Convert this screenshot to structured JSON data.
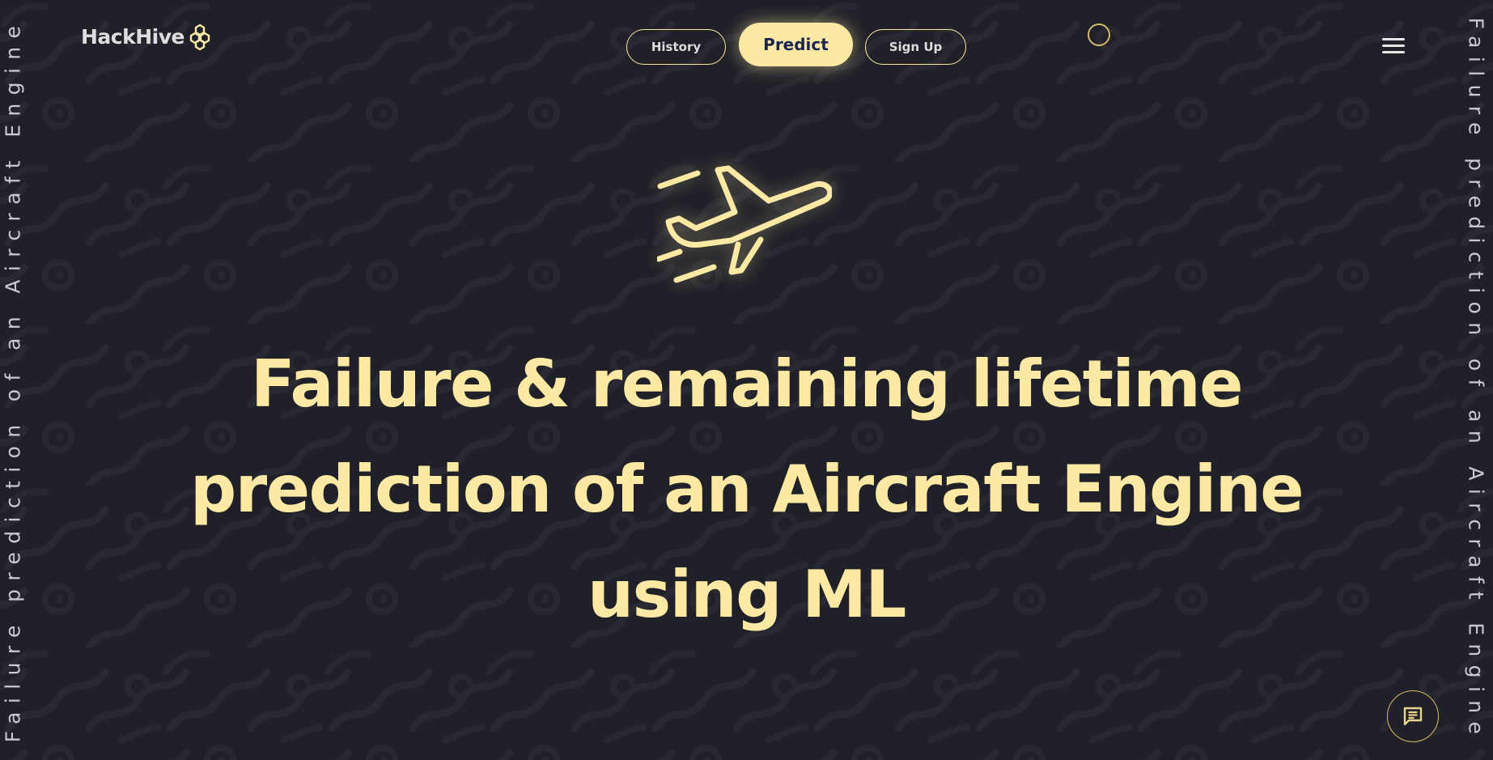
{
  "brand": {
    "name": "HackHive",
    "logo_icon": "honeycomb-icon",
    "accent_color": "#fde9a3",
    "background_color": "#1f2028"
  },
  "side_text": {
    "left": "Failure prediction of an Aircraft Engine",
    "right": "Failure prediction of an Aircraft Engine"
  },
  "nav": {
    "history_label": "History",
    "predict_label": "Predict",
    "signup_label": "Sign Up",
    "menu_icon": "hamburger-menu-icon"
  },
  "hero": {
    "icon": "airplane-icon",
    "title": "Failure & remaining lifetime prediction of an Aircraft Engine using ML"
  },
  "chat": {
    "icon": "chat-icon"
  }
}
